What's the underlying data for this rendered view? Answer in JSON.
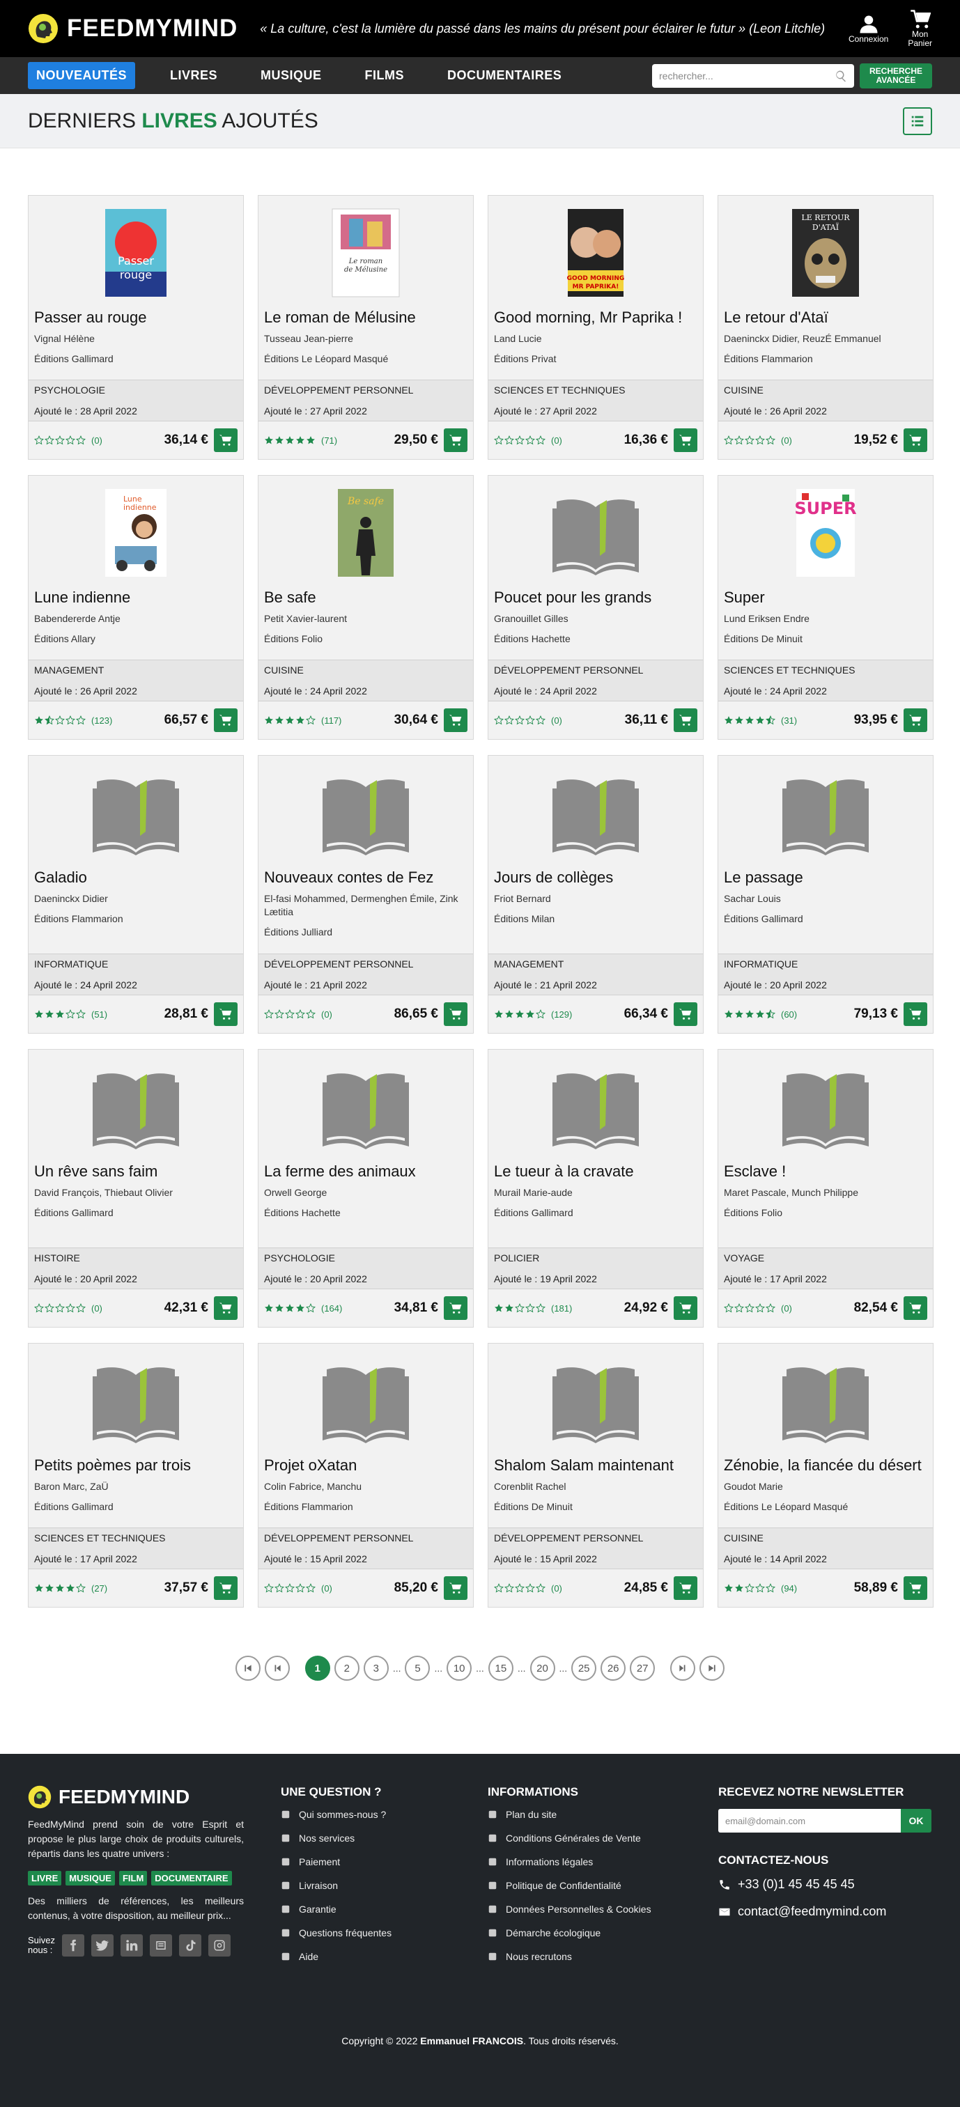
{
  "header": {
    "brand": "FEEDMYMIND",
    "quote": "« La culture, c'est la lumière du passé dans les mains du présent pour éclairer le futur » (Leon Litchle)",
    "login_label": "Connexion",
    "cart_label_1": "Mon",
    "cart_label_2": "Panier"
  },
  "nav": {
    "items": [
      "NOUVEAUTÉS",
      "LIVRES",
      "MUSIQUE",
      "FILMS",
      "DOCUMENTAIRES"
    ],
    "search_placeholder": "rechercher...",
    "advanced_1": "RECHERCHE",
    "advanced_2": "AVANCÉE"
  },
  "page": {
    "title_pre": "DERNIERS ",
    "title_hl": "LIVRES",
    "title_post": " AJOUTÉS"
  },
  "books": [
    {
      "title": "Passer au rouge",
      "author": "Vignal Hélène",
      "publisher": "Éditions Gallimard",
      "category": "PSYCHOLOGIE",
      "date": "Ajouté le : 28 April 2022",
      "rating": 0,
      "count": "(0)",
      "price": "36,14 €",
      "cover": "rouge"
    },
    {
      "title": "Le roman de Mélusine",
      "author": "Tusseau Jean-pierre",
      "publisher": "Éditions Le Léopard Masqué",
      "category": "DÉVELOPPEMENT PERSONNEL",
      "date": "Ajouté le : 27 April 2022",
      "rating": 5,
      "count": "(71)",
      "price": "29,50 €",
      "cover": "melusine"
    },
    {
      "title": "Good morning, Mr Paprika !",
      "author": "Land Lucie",
      "publisher": "Éditions Privat",
      "category": "SCIENCES ET TECHNIQUES",
      "date": "Ajouté le : 27 April 2022",
      "rating": 0,
      "count": "(0)",
      "price": "16,36 €",
      "cover": "paprika"
    },
    {
      "title": "Le retour d'Ataï",
      "author": "Daeninckx Didier, ReuzÉ Emmanuel",
      "publisher": "Éditions Flammarion",
      "category": "CUISINE",
      "date": "Ajouté le : 26 April 2022",
      "rating": 0,
      "count": "(0)",
      "price": "19,52 €",
      "cover": "atai"
    },
    {
      "title": "Lune indienne",
      "author": "Babendererde Antje",
      "publisher": "Éditions Allary",
      "category": "MANAGEMENT",
      "date": "Ajouté le : 26 April 2022",
      "rating": 1.5,
      "count": "(123)",
      "price": "66,57 €",
      "cover": "lune"
    },
    {
      "title": "Be safe",
      "author": "Petit Xavier-laurent",
      "publisher": "Éditions Folio",
      "category": "CUISINE",
      "date": "Ajouté le : 24 April 2022",
      "rating": 4,
      "count": "(117)",
      "price": "30,64 €",
      "cover": "safe"
    },
    {
      "title": "Poucet pour les grands",
      "author": "Granouillet Gilles",
      "publisher": "Éditions Hachette",
      "category": "DÉVELOPPEMENT PERSONNEL",
      "date": "Ajouté le : 24 April 2022",
      "rating": 0,
      "count": "(0)",
      "price": "36,11 €",
      "cover": "default"
    },
    {
      "title": "Super",
      "author": "Lund Eriksen Endre",
      "publisher": "Éditions De Minuit",
      "category": "SCIENCES ET TECHNIQUES",
      "date": "Ajouté le : 24 April 2022",
      "rating": 4.5,
      "count": "(31)",
      "price": "93,95 €",
      "cover": "super"
    },
    {
      "title": "Galadio",
      "author": "Daeninckx Didier",
      "publisher": "Éditions Flammarion",
      "category": "INFORMATIQUE",
      "date": "Ajouté le : 24 April 2022",
      "rating": 3,
      "count": "(51)",
      "price": "28,81 €",
      "cover": "default"
    },
    {
      "title": "Nouveaux contes de Fez",
      "author": "El-fasi Mohammed, Dermenghen Émile, Zink Lætitia",
      "publisher": "Éditions Julliard",
      "category": "DÉVELOPPEMENT PERSONNEL",
      "date": "Ajouté le : 21 April 2022",
      "rating": 0,
      "count": "(0)",
      "price": "86,65 €",
      "cover": "default"
    },
    {
      "title": "Jours de collèges",
      "author": "Friot Bernard",
      "publisher": "Éditions Milan",
      "category": "MANAGEMENT",
      "date": "Ajouté le : 21 April 2022",
      "rating": 4,
      "count": "(129)",
      "price": "66,34 €",
      "cover": "default"
    },
    {
      "title": "Le passage",
      "author": "Sachar Louis",
      "publisher": "Éditions Gallimard",
      "category": "INFORMATIQUE",
      "date": "Ajouté le : 20 April 2022",
      "rating": 4.5,
      "count": "(60)",
      "price": "79,13 €",
      "cover": "default"
    },
    {
      "title": "Un rêve sans faim",
      "author": "David François, Thiebaut Olivier",
      "publisher": "Éditions Gallimard",
      "category": "HISTOIRE",
      "date": "Ajouté le : 20 April 2022",
      "rating": 0,
      "count": "(0)",
      "price": "42,31 €",
      "cover": "default"
    },
    {
      "title": "La ferme des animaux",
      "author": "Orwell George",
      "publisher": "Éditions Hachette",
      "category": "PSYCHOLOGIE",
      "date": "Ajouté le : 20 April 2022",
      "rating": 4,
      "count": "(164)",
      "price": "34,81 €",
      "cover": "default"
    },
    {
      "title": "Le tueur à la cravate",
      "author": "Murail Marie-aude",
      "publisher": "Éditions Gallimard",
      "category": "POLICIER",
      "date": "Ajouté le : 19 April 2022",
      "rating": 2,
      "count": "(181)",
      "price": "24,92 €",
      "cover": "default"
    },
    {
      "title": "Esclave !",
      "author": "Maret Pascale, Munch Philippe",
      "publisher": "Éditions Folio",
      "category": "VOYAGE",
      "date": "Ajouté le : 17 April 2022",
      "rating": 0,
      "count": "(0)",
      "price": "82,54 €",
      "cover": "default"
    },
    {
      "title": "Petits poèmes par trois",
      "author": "Baron Marc, ZaÜ",
      "publisher": "Éditions Gallimard",
      "category": "SCIENCES ET TECHNIQUES",
      "date": "Ajouté le : 17 April 2022",
      "rating": 4,
      "count": "(27)",
      "price": "37,57 €",
      "cover": "default"
    },
    {
      "title": "Projet oXatan",
      "author": "Colin Fabrice, Manchu",
      "publisher": "Éditions Flammarion",
      "category": "DÉVELOPPEMENT PERSONNEL",
      "date": "Ajouté le : 15 April 2022",
      "rating": 0,
      "count": "(0)",
      "price": "85,20 €",
      "cover": "default"
    },
    {
      "title": "Shalom Salam maintenant",
      "author": "Corenblit Rachel",
      "publisher": "Éditions De Minuit",
      "category": "DÉVELOPPEMENT PERSONNEL",
      "date": "Ajouté le : 15 April 2022",
      "rating": 0,
      "count": "(0)",
      "price": "24,85 €",
      "cover": "default"
    },
    {
      "title": "Zénobie, la fiancée du désert",
      "author": "Goudot Marie",
      "publisher": "Éditions Le Léopard Masqué",
      "category": "CUISINE",
      "date": "Ajouté le : 14 April 2022",
      "rating": 2,
      "count": "(94)",
      "price": "58,89 €",
      "cover": "default"
    }
  ],
  "pagination": {
    "pages": [
      "1",
      "2",
      "3",
      "5",
      "10",
      "15",
      "20",
      "25",
      "26",
      "27"
    ],
    "current": "1",
    "ellipsis": "..."
  },
  "footer": {
    "brand": "FEEDMYMIND",
    "about": "FeedMyMind prend soin de votre Esprit et propose le plus large choix de produits culturels, répartis dans les quatre univers :",
    "tags": [
      "LIVRE",
      "MUSIQUE",
      "FILM",
      "DOCUMENTAIRE"
    ],
    "about2": "Des milliers de références, les meilleurs contenus, à votre disposition, au meilleur prix...",
    "follow_1": "Suivez",
    "follow_2": "nous :",
    "social": [
      "facebook-icon",
      "twitter-icon",
      "linkedin-icon",
      "cdiscount-icon",
      "tiktok-icon",
      "instagram-icon"
    ],
    "question_title": "UNE QUESTION ?",
    "question_links": [
      "Qui sommes-nous ?",
      "Nos services",
      "Paiement",
      "Livraison",
      "Garantie",
      "Questions fréquentes",
      "Aide"
    ],
    "info_title": "INFORMATIONS",
    "info_links": [
      "Plan du site",
      "Conditions Générales de Vente",
      "Informations légales",
      "Politique de Confidentialité",
      "Données Personnelles & Cookies",
      "Démarche écologique",
      "Nous recrutons"
    ],
    "newsletter_title": "RECEVEZ NOTRE NEWSLETTER",
    "newsletter_placeholder": "email@domain.com",
    "newsletter_btn": "OK",
    "contact_title": "CONTACTEZ-NOUS",
    "phone": "+33 (0)1 45 45 45 45",
    "email": "contact@feedmymind.com",
    "copyright_pre": "Copyright © 2022 ",
    "copyright_name": "Emmanuel FRANCOIS",
    "copyright_post": ". Tous droits réservés."
  },
  "colors": {
    "accent": "#1e8a4c",
    "active_nav": "#1f7fe0",
    "footer_bg": "#212529"
  }
}
